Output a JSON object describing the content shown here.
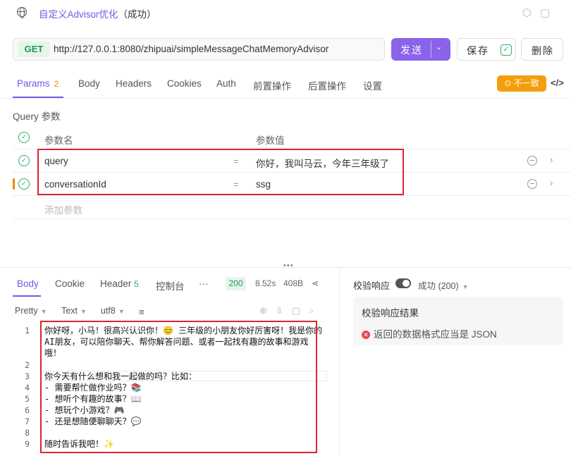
{
  "window": {
    "title": "自定义Advisor优化",
    "status": "（成功）"
  },
  "request": {
    "method": "GET",
    "url": "http://127.0.0.1:8080/zhipuai/simpleMessageChatMemoryAdvisor",
    "send_label": "发送",
    "save_label": "保存",
    "delete_label": "删除"
  },
  "tabs": [
    {
      "label": "Params",
      "count": "2"
    },
    {
      "label": "Body"
    },
    {
      "label": "Headers"
    },
    {
      "label": "Cookies"
    },
    {
      "label": "Auth"
    },
    {
      "label": "前置操作"
    },
    {
      "label": "后置操作"
    },
    {
      "label": "设置"
    }
  ],
  "mismatch_label": "不一致",
  "query": {
    "title": "Query 参数",
    "name_header": "参数名",
    "value_header": "参数值",
    "rows": [
      {
        "name": "query",
        "eq": "=",
        "value": "你好，我叫马云，今年三年级了"
      },
      {
        "name": "conversationId",
        "eq": "=",
        "value": "ssg"
      }
    ],
    "add_placeholder": "添加参数"
  },
  "response": {
    "tabs": [
      {
        "label": "Body"
      },
      {
        "label": "Cookie"
      },
      {
        "label": "Header",
        "count": "5"
      },
      {
        "label": "控制台"
      },
      {
        "label": "···"
      }
    ],
    "status_code": "200",
    "time": "8.52s",
    "size": "408B",
    "format": {
      "pretty": "Pretty",
      "type": "Text",
      "encoding": "utf8"
    },
    "lines": [
      {
        "num": "1",
        "text": "你好呀，小马！很高兴认识你！😊 三年级的小朋友你好厉害呀！我是你的AI朋友，可以陪你聊天、帮你解答问题、或者一起找有趣的故事和游戏哦！"
      },
      {
        "num": "2",
        "text": ""
      },
      {
        "num": "3",
        "text": "你今天有什么想和我一起做的吗？比如："
      },
      {
        "num": "4",
        "text": "- 需要帮忙做作业吗？📚"
      },
      {
        "num": "5",
        "text": "- 想听个有趣的故事？📖"
      },
      {
        "num": "6",
        "text": "- 想玩个小游戏？🎮"
      },
      {
        "num": "7",
        "text": "- 还是想随便聊聊天？💬"
      },
      {
        "num": "8",
        "text": ""
      },
      {
        "num": "9",
        "text": "随时告诉我吧！✨"
      }
    ]
  },
  "validation": {
    "label": "校验响应",
    "status": "成功 (200)",
    "card_title": "校验响应结果",
    "error": "返回的数据格式应当是 JSON"
  },
  "colors": {
    "accent": "#8a63ea",
    "success": "#2bae66",
    "warning": "#f59e0b",
    "error": "#d9272e"
  }
}
